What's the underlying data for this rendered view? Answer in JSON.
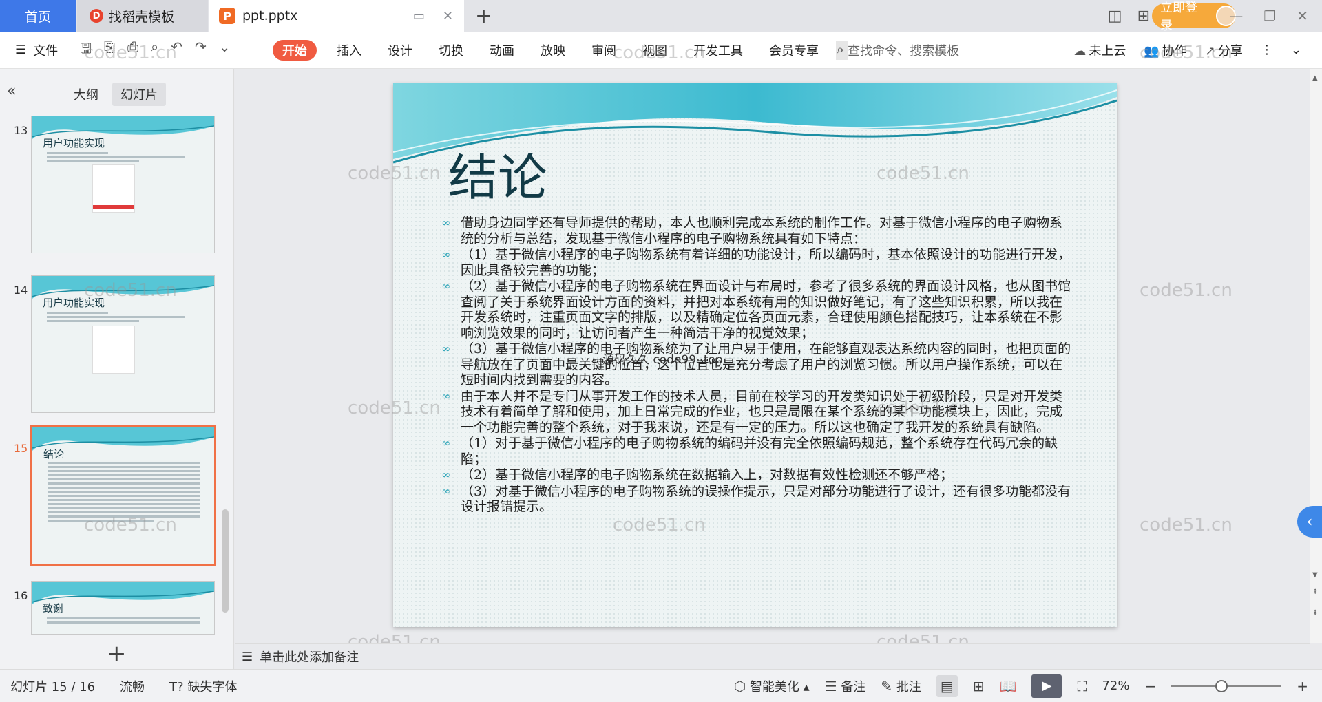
{
  "tabs": {
    "home": "首页",
    "docer": "找稻壳模板",
    "document": "ppt.pptx",
    "docer_logo": "D",
    "ppt_logo": "P"
  },
  "window": {
    "login": "立即登录"
  },
  "ribbon": {
    "file": "文件",
    "tabs": [
      "开始",
      "插入",
      "设计",
      "切换",
      "动画",
      "放映",
      "审阅",
      "视图",
      "开发工具",
      "会员专享"
    ],
    "search_placeholder": "查找命令、搜索模板",
    "cloud": "未上云",
    "collab": "协作",
    "share": "分享"
  },
  "left_panel": {
    "tab_outline": "大纲",
    "tab_slides": "幻灯片",
    "thumbnails": [
      {
        "number": "13",
        "title": "用户功能实现"
      },
      {
        "number": "14",
        "title": "用户功能实现"
      },
      {
        "number": "15",
        "title": "结论"
      },
      {
        "number": "16",
        "title": "致谢"
      }
    ]
  },
  "slide": {
    "title": "结论",
    "bullets": [
      "借助身边同学还有导师提供的帮助，本人也顺利完成本系统的制作工作。对基于微信小程序的电子购物系统的分析与总结，发现基于微信小程序的电子购物系统具有如下特点：",
      "（1）基于微信小程序的电子购物系统有着详细的功能设计，所以编码时，基本依照设计的功能进行开发，因此具备较完善的功能；",
      "（2）基于微信小程序的电子购物系统在界面设计与布局时，参考了很多系统的界面设计风格，也从图书馆查阅了关于系统界面设计方面的资料，并把对本系统有用的知识做好笔记，有了这些知识积累，所以我在开发系统时，注重页面文字的排版，以及精确定位各页面元素，合理使用颜色搭配技巧，让本系统在不影响浏览效果的同时，让访问者产生一种简洁干净的视觉效果；",
      "（3）基于微信小程序的电子购物系统为了让用户易于使用，在能够直观表达系统内容的同时，也把页面的导航放在了页面中最关键的位置，这个位置也是充分考虑了用户的浏览习惯。所以用户操作系统，可以在短时间内找到需要的内容。",
      "由于本人并不是专门从事开发工作的技术人员，目前在校学习的开发类知识处于初级阶段，只是对开发类技术有着简单了解和使用，加上日常完成的作业，也只是局限在某个系统的某个功能模块上，因此，完成一个功能完善的整个系统，对于我来说，还是有一定的压力。所以这也确定了我开发的系统具有缺陷。",
      "（1）对于基于微信小程序的电子购物系统的编码并没有完全依照编码规范，整个系统存在代码冗余的缺陷；",
      "（2）基于微信小程序的电子购物系统在数据输入上，对数据有效性检测还不够严格；",
      "（3）对基于微信小程序的电子购物系统的误操作提示，只是对部分功能进行了设计，还有很多功能都没有设计报错提示。"
    ],
    "overlay_text": "源码久久 code99. top"
  },
  "watermark": "code51.cn",
  "notes_placeholder": "单击此处添加备注",
  "status": {
    "slide_counter": "幻灯片 15 / 16",
    "smooth": "流畅",
    "missing_font": "缺失字体",
    "beautify": "智能美化",
    "notes": "备注",
    "comments": "批注",
    "zoom": "72%"
  },
  "colors": {
    "accent": "#f05b41",
    "home_tab": "#3e78e8",
    "login": "#f6a93b",
    "thumb_selected": "#f07046"
  }
}
